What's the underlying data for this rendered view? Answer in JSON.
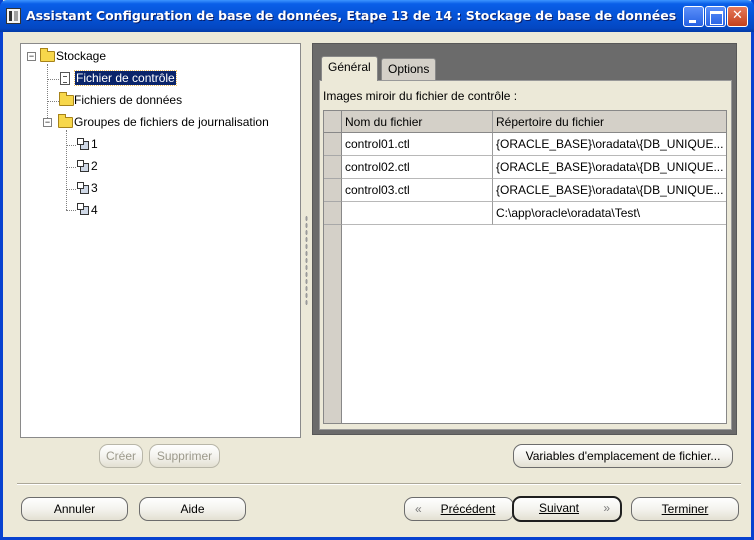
{
  "window": {
    "title": "Assistant Configuration de base de données, Etape 13 de 14 : Stockage de base de données"
  },
  "tree": {
    "root": "Stockage",
    "items": [
      {
        "label": "Fichier de contrôle",
        "icon": "document-icon",
        "selected": true
      },
      {
        "label": "Fichiers de données",
        "icon": "folder-icon"
      },
      {
        "label": "Groupes de fichiers de journalisation",
        "icon": "folder-icon",
        "children": [
          "1",
          "2",
          "3",
          "4"
        ]
      }
    ]
  },
  "tabs": [
    {
      "label": "Général",
      "active": true
    },
    {
      "label": "Options",
      "active": false
    }
  ],
  "general": {
    "section_label": "Images miroir du fichier de contrôle :",
    "columns": [
      "Nom du fichier",
      "Répertoire du fichier"
    ],
    "rows": [
      [
        "control01.ctl",
        "{ORACLE_BASE}\\oradata\\{DB_UNIQUE..."
      ],
      [
        "control02.ctl",
        "{ORACLE_BASE}\\oradata\\{DB_UNIQUE..."
      ],
      [
        "control03.ctl",
        "{ORACLE_BASE}\\oradata\\{DB_UNIQUE..."
      ],
      [
        "",
        "C:\\app\\oracle\\oradata\\Test\\"
      ]
    ]
  },
  "buttons": {
    "create": "Créer",
    "delete": "Supprimer",
    "file_location_vars": "Variables d'emplacement de fichier...",
    "cancel": "Annuler",
    "help": "Aide",
    "previous": "Précédent",
    "next": "Suivant",
    "finish": "Terminer"
  },
  "colors": {
    "titlebar": "#0553d6",
    "selection": "#0a246a",
    "panel_dark": "#6b6b6b",
    "window_bg": "#ece9d8"
  }
}
